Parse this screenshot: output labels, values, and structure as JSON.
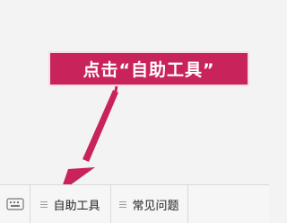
{
  "callout": {
    "text": "点击“自助工具”"
  },
  "bottom_menu": {
    "tabs": [
      {
        "label": "自助工具"
      },
      {
        "label": "常见问题"
      },
      {
        "label": ""
      }
    ]
  },
  "colors": {
    "accent": "#c8235a",
    "background": "#f3f3f3"
  },
  "icons": [
    "keyboard-icon",
    "menu-lines-icon",
    "menu-lines-icon"
  ]
}
